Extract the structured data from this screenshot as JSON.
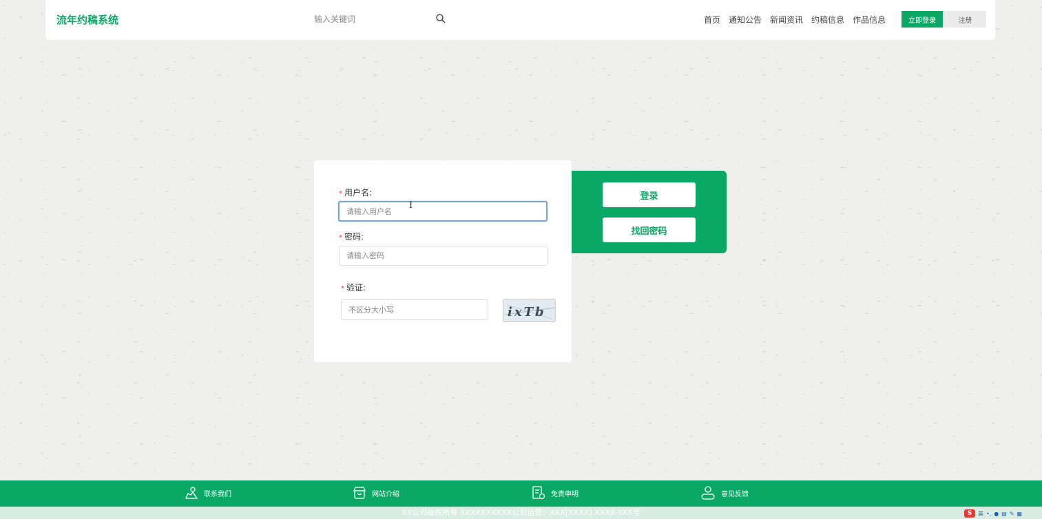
{
  "header": {
    "brand": "流年约稿系统",
    "search_placeholder": "输入关键词",
    "nav": [
      "首页",
      "通知公告",
      "新闻资讯",
      "约稿信息",
      "作品信息"
    ],
    "login_label": "立即登录",
    "register_label": "注册"
  },
  "login_form": {
    "username_label": "用户名:",
    "username_placeholder": "请输入用户名",
    "password_label": "密码:",
    "password_placeholder": "请输入密码",
    "captcha_label": "验证:",
    "captcha_placeholder": "不区分大小写",
    "captcha_text": "ixTb",
    "required_mark": "*"
  },
  "side_panel": {
    "login_label": "登录",
    "forgot_label": "找回密码"
  },
  "footer": {
    "items": [
      {
        "label": "联系我们",
        "icon": "contact-icon"
      },
      {
        "label": "网站介绍",
        "icon": "store-icon"
      },
      {
        "label": "免责申明",
        "icon": "document-icon"
      },
      {
        "label": "意见反馈",
        "icon": "user-icon"
      }
    ],
    "copyright": "XX公司版权所有 XXXXXXXXXX公司运营：XXX[XXXX] XXXX-XXX号"
  },
  "ime": {
    "logo": "S",
    "lang": "英"
  },
  "colors": {
    "accent": "#0aa865",
    "required": "#e53935"
  }
}
